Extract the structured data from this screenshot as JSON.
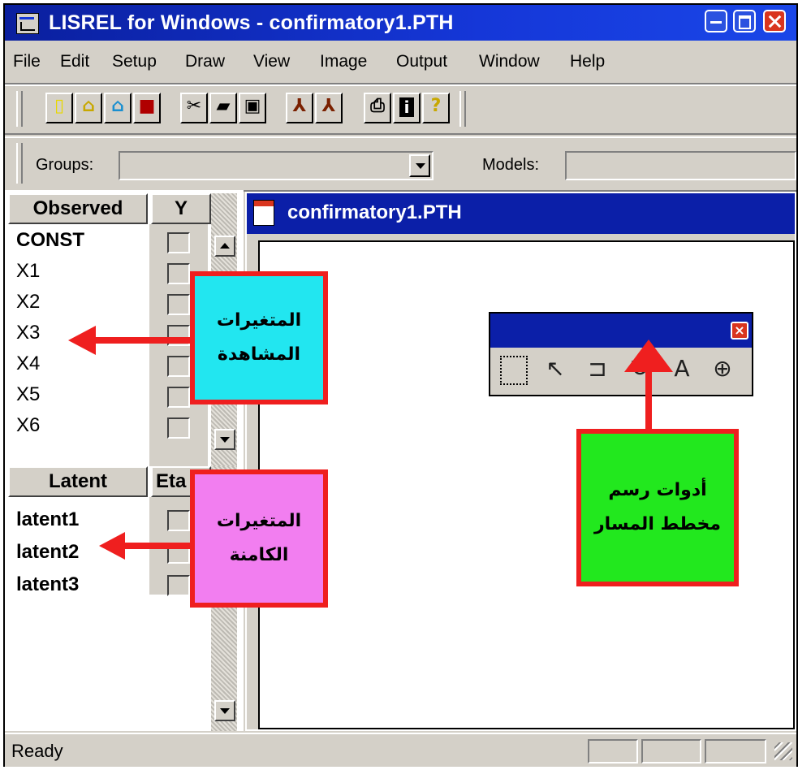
{
  "window": {
    "title": "LISREL for Windows - confirmatory1.PTH"
  },
  "menu": [
    "File",
    "Edit",
    "Setup",
    "Draw",
    "View",
    "Image",
    "Output",
    "Window",
    "Help"
  ],
  "toolbar": {
    "buttons": [
      "new-file-icon",
      "open-folder-icon",
      "open-folder-alt-icon",
      "save-icon",
      "cut-icon",
      "copy-icon",
      "paste-icon",
      "path-diagram-icon",
      "path-diagram-alt-icon",
      "print-icon",
      "info-icon",
      "help-icon"
    ]
  },
  "groups_bar": {
    "groups_label": "Groups:",
    "groups_value": "",
    "models_label": "Models:",
    "models_value": ""
  },
  "observed_panel": {
    "header": "Observed",
    "column": "Y",
    "variables": [
      "CONST",
      "X1",
      "X2",
      "X3",
      "X4",
      "X5",
      "X6"
    ]
  },
  "latent_panel": {
    "header": "Latent",
    "column": "Eta",
    "variables": [
      "latent1",
      "latent2",
      "latent3"
    ]
  },
  "document": {
    "title": "confirmatory1.PTH"
  },
  "draw_tools": [
    "select-rectangle-icon",
    "arrow-icon",
    "path-arrow-icon",
    "curved-arrow-icon",
    "text-icon",
    "zoom-icon"
  ],
  "status": {
    "text": "Ready"
  },
  "annotations": {
    "observed_line1": "المتغيرات",
    "observed_line2": "المشاهدة",
    "latent_line1": "المتغيرات",
    "latent_line2": "الكامنة",
    "tools_line1": "أدوات رسم",
    "tools_line2": "مخطط المسار"
  },
  "colors": {
    "title_bar": "#1537d8",
    "annotation_border": "#ef1f1f",
    "observed_box": "#22e6f0",
    "latent_box": "#f27ef0",
    "tools_box": "#22e81e"
  }
}
